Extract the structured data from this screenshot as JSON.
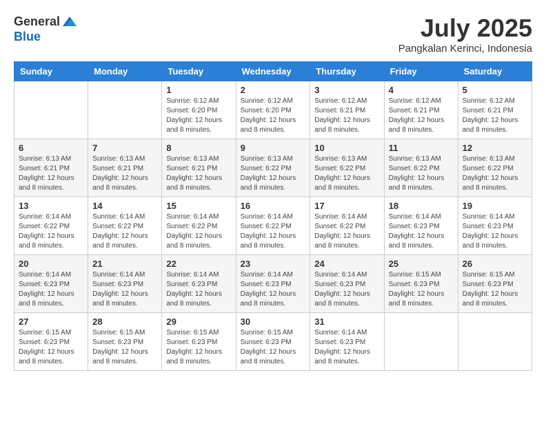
{
  "logo": {
    "text_general": "General",
    "text_blue": "Blue"
  },
  "header": {
    "month": "July 2025",
    "location": "Pangkalan Kerinci, Indonesia"
  },
  "weekdays": [
    "Sunday",
    "Monday",
    "Tuesday",
    "Wednesday",
    "Thursday",
    "Friday",
    "Saturday"
  ],
  "weeks": [
    [
      {
        "day": "",
        "info": ""
      },
      {
        "day": "",
        "info": ""
      },
      {
        "day": "1",
        "info": "Sunrise: 6:12 AM\nSunset: 6:20 PM\nDaylight: 12 hours and 8 minutes."
      },
      {
        "day": "2",
        "info": "Sunrise: 6:12 AM\nSunset: 6:20 PM\nDaylight: 12 hours and 8 minutes."
      },
      {
        "day": "3",
        "info": "Sunrise: 6:12 AM\nSunset: 6:21 PM\nDaylight: 12 hours and 8 minutes."
      },
      {
        "day": "4",
        "info": "Sunrise: 6:12 AM\nSunset: 6:21 PM\nDaylight: 12 hours and 8 minutes."
      },
      {
        "day": "5",
        "info": "Sunrise: 6:12 AM\nSunset: 6:21 PM\nDaylight: 12 hours and 8 minutes."
      }
    ],
    [
      {
        "day": "6",
        "info": "Sunrise: 6:13 AM\nSunset: 6:21 PM\nDaylight: 12 hours and 8 minutes."
      },
      {
        "day": "7",
        "info": "Sunrise: 6:13 AM\nSunset: 6:21 PM\nDaylight: 12 hours and 8 minutes."
      },
      {
        "day": "8",
        "info": "Sunrise: 6:13 AM\nSunset: 6:21 PM\nDaylight: 12 hours and 8 minutes."
      },
      {
        "day": "9",
        "info": "Sunrise: 6:13 AM\nSunset: 6:22 PM\nDaylight: 12 hours and 8 minutes."
      },
      {
        "day": "10",
        "info": "Sunrise: 6:13 AM\nSunset: 6:22 PM\nDaylight: 12 hours and 8 minutes."
      },
      {
        "day": "11",
        "info": "Sunrise: 6:13 AM\nSunset: 6:22 PM\nDaylight: 12 hours and 8 minutes."
      },
      {
        "day": "12",
        "info": "Sunrise: 6:13 AM\nSunset: 6:22 PM\nDaylight: 12 hours and 8 minutes."
      }
    ],
    [
      {
        "day": "13",
        "info": "Sunrise: 6:14 AM\nSunset: 6:22 PM\nDaylight: 12 hours and 8 minutes."
      },
      {
        "day": "14",
        "info": "Sunrise: 6:14 AM\nSunset: 6:22 PM\nDaylight: 12 hours and 8 minutes."
      },
      {
        "day": "15",
        "info": "Sunrise: 6:14 AM\nSunset: 6:22 PM\nDaylight: 12 hours and 8 minutes."
      },
      {
        "day": "16",
        "info": "Sunrise: 6:14 AM\nSunset: 6:22 PM\nDaylight: 12 hours and 8 minutes."
      },
      {
        "day": "17",
        "info": "Sunrise: 6:14 AM\nSunset: 6:22 PM\nDaylight: 12 hours and 8 minutes."
      },
      {
        "day": "18",
        "info": "Sunrise: 6:14 AM\nSunset: 6:23 PM\nDaylight: 12 hours and 8 minutes."
      },
      {
        "day": "19",
        "info": "Sunrise: 6:14 AM\nSunset: 6:23 PM\nDaylight: 12 hours and 8 minutes."
      }
    ],
    [
      {
        "day": "20",
        "info": "Sunrise: 6:14 AM\nSunset: 6:23 PM\nDaylight: 12 hours and 8 minutes."
      },
      {
        "day": "21",
        "info": "Sunrise: 6:14 AM\nSunset: 6:23 PM\nDaylight: 12 hours and 8 minutes."
      },
      {
        "day": "22",
        "info": "Sunrise: 6:14 AM\nSunset: 6:23 PM\nDaylight: 12 hours and 8 minutes."
      },
      {
        "day": "23",
        "info": "Sunrise: 6:14 AM\nSunset: 6:23 PM\nDaylight: 12 hours and 8 minutes."
      },
      {
        "day": "24",
        "info": "Sunrise: 6:14 AM\nSunset: 6:23 PM\nDaylight: 12 hours and 8 minutes."
      },
      {
        "day": "25",
        "info": "Sunrise: 6:15 AM\nSunset: 6:23 PM\nDaylight: 12 hours and 8 minutes."
      },
      {
        "day": "26",
        "info": "Sunrise: 6:15 AM\nSunset: 6:23 PM\nDaylight: 12 hours and 8 minutes."
      }
    ],
    [
      {
        "day": "27",
        "info": "Sunrise: 6:15 AM\nSunset: 6:23 PM\nDaylight: 12 hours and 8 minutes."
      },
      {
        "day": "28",
        "info": "Sunrise: 6:15 AM\nSunset: 6:23 PM\nDaylight: 12 hours and 8 minutes."
      },
      {
        "day": "29",
        "info": "Sunrise: 6:15 AM\nSunset: 6:23 PM\nDaylight: 12 hours and 8 minutes."
      },
      {
        "day": "30",
        "info": "Sunrise: 6:15 AM\nSunset: 6:23 PM\nDaylight: 12 hours and 8 minutes."
      },
      {
        "day": "31",
        "info": "Sunrise: 6:14 AM\nSunset: 6:23 PM\nDaylight: 12 hours and 8 minutes."
      },
      {
        "day": "",
        "info": ""
      },
      {
        "day": "",
        "info": ""
      }
    ]
  ]
}
